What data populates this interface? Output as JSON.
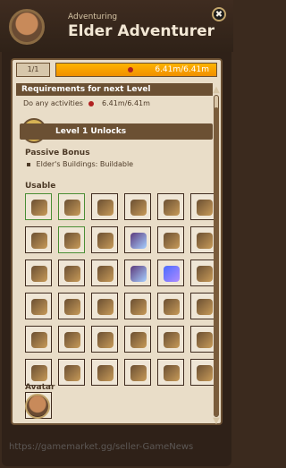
{
  "header": {
    "subtitle": "Adventuring",
    "title": "Elder Adventurer",
    "close_symbol": "✖"
  },
  "progress": {
    "level": "1/1",
    "value_text": "6.41m/6.41m",
    "fraction": 1.0
  },
  "requirements": {
    "heading": "Requirements for next Level",
    "text": "Do any activities",
    "value": "6.41m/6.41m"
  },
  "unlocks": {
    "heading": "Level 1 Unlocks",
    "passive_title": "Passive Bonus",
    "passive_item": "Elder's Buildings: Buildable",
    "usable_title": "Usable",
    "avatar_title": "Avatar"
  },
  "grid": {
    "items": [
      "item-1",
      "item-2",
      "item-3",
      "item-4",
      "item-5",
      "item-6",
      "item-7",
      "item-8",
      "item-9",
      "item-10",
      "item-11",
      "item-12",
      "item-13",
      "item-14",
      "item-15",
      "item-16",
      "item-17",
      "item-18",
      "item-19",
      "item-20",
      "item-21",
      "item-22",
      "item-23",
      "item-24",
      "item-25",
      "item-26",
      "item-27",
      "item-28",
      "item-29",
      "item-30",
      "item-31",
      "item-32",
      "item-33",
      "item-34",
      "item-35",
      "item-36",
      "item-37"
    ]
  },
  "watermark": "https://gamemarket.gg/seller-GameNews"
}
